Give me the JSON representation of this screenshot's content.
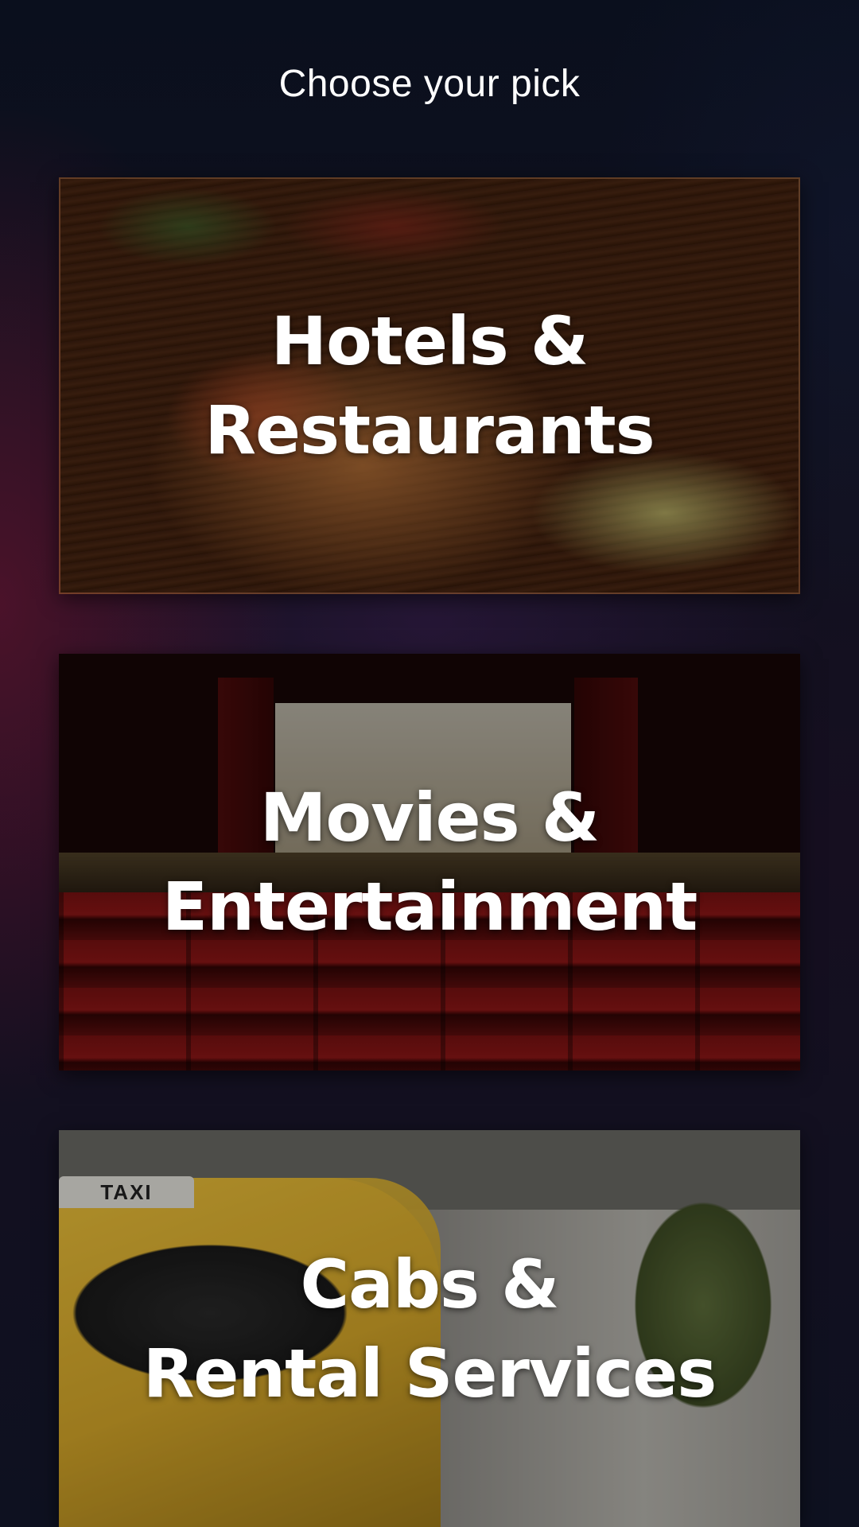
{
  "header": {
    "title": "Choose your pick"
  },
  "cards": [
    {
      "id": "hotels",
      "line1": "Hotels &",
      "line2": "Restaurants",
      "image": "burrito-food-photo"
    },
    {
      "id": "movies",
      "line1": "Movies &",
      "line2": "Entertainment",
      "image": "cinema-hall-photo"
    },
    {
      "id": "cabs",
      "line1": "Cabs &",
      "line2": "Rental Services",
      "image": "yellow-taxis-photo",
      "sign_text": "TAXI"
    }
  ]
}
